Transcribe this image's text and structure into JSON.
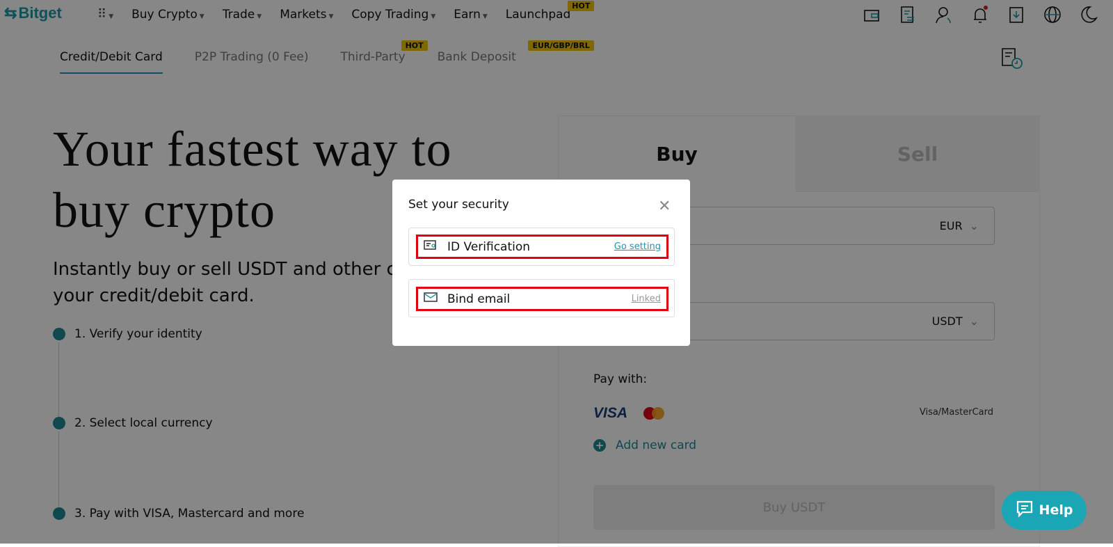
{
  "nav": {
    "logo": "Bitget",
    "items": [
      {
        "label": "Buy Crypto",
        "caret": true
      },
      {
        "label": "Trade",
        "caret": true
      },
      {
        "label": "Markets",
        "caret": true
      },
      {
        "label": "Copy Trading",
        "caret": true
      },
      {
        "label": "Earn",
        "caret": true
      },
      {
        "label": "Launchpad",
        "caret": false,
        "badge": "HOT"
      }
    ],
    "icons": [
      "wallet-icon",
      "orders-icon",
      "user-icon",
      "bell-icon",
      "download-icon",
      "globe-icon",
      "moon-icon"
    ]
  },
  "tabs": [
    {
      "label": "Credit/Debit Card",
      "active": true
    },
    {
      "label": "P2P Trading (0 Fee)"
    },
    {
      "label": "Third-Party",
      "badge": "HOT"
    },
    {
      "label": "Bank Deposit",
      "badge": "EUR/GBP/BRL"
    }
  ],
  "hero": {
    "line1": "Your fastest way to",
    "line2": "buy crypto",
    "subtitle_line1": "Instantly buy or sell USDT and other c",
    "subtitle_line2": "your credit/debit card."
  },
  "steps": [
    "1. Verify your identity",
    "2. Select local currency",
    "3. Pay with VISA, Mastercard and more"
  ],
  "panel": {
    "buy_tab": "Buy",
    "sell_tab": "Sell",
    "fiat": "EUR",
    "crypto": "USDT",
    "pay_with": "Pay with:",
    "visa": "VISA",
    "card_types": "Visa/MasterCard",
    "add_card": "Add new card",
    "buy_button": "Buy USDT"
  },
  "help": "Help",
  "modal": {
    "title": "Set your security",
    "rows": [
      {
        "label": "ID Verification",
        "action": "Go setting"
      },
      {
        "label": "Bind email",
        "action": "Linked"
      }
    ]
  },
  "colors": {
    "accent": "#1d9aa8",
    "highlight": "#e00010",
    "badge": "#f0c400"
  }
}
